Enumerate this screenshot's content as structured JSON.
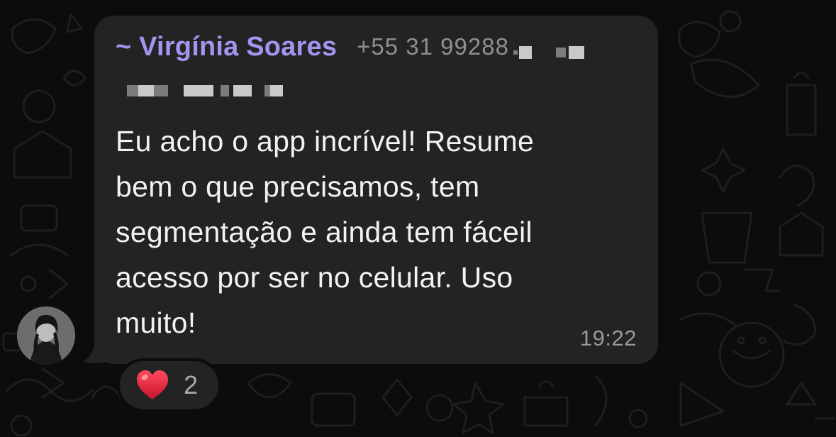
{
  "message": {
    "sender_prefix": "~",
    "sender_name": "Virgínia Soares",
    "sender_phone": "+55 31 99288",
    "lines": [
      "Eu acho o app incrível! Resume",
      "bem o que precisamos, tem",
      "segmentação e ainda tem fáceil",
      "acesso por ser no celular. Uso",
      "muito!"
    ],
    "time": "19:22"
  },
  "reaction": {
    "emoji_icon": "heart-icon",
    "count": "2"
  },
  "colors": {
    "sender_name": "#a394f0",
    "bubble": "#232323",
    "background": "#0c0c0c",
    "heart": "#e0243a"
  }
}
